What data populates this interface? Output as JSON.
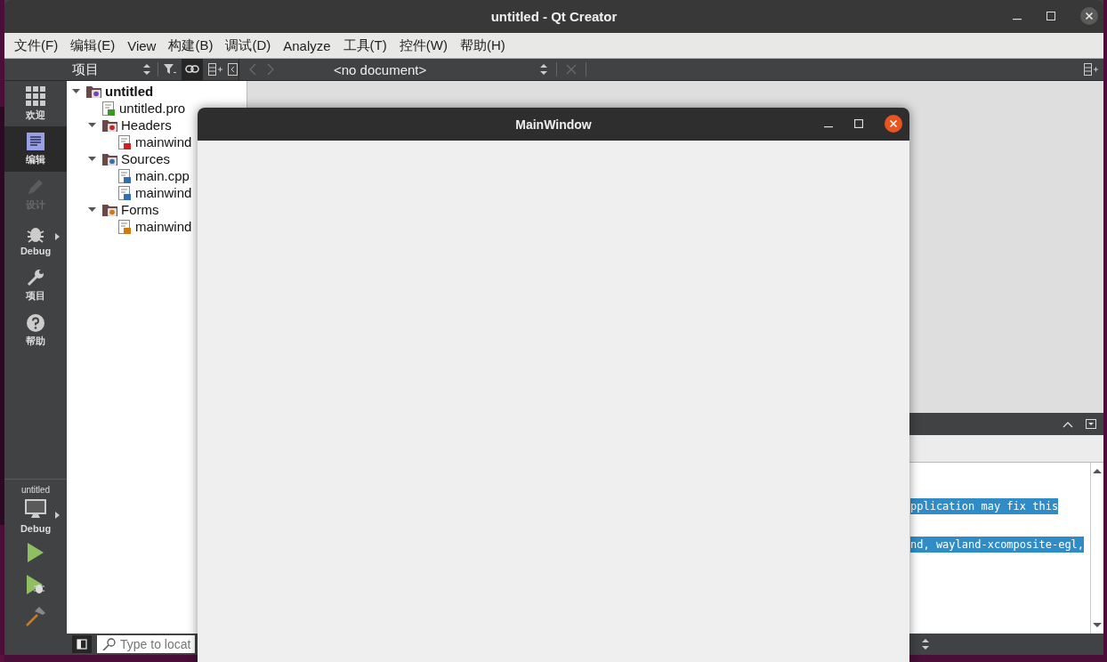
{
  "window": {
    "title": "untitled - Qt Creator"
  },
  "menu": [
    {
      "label": "文件(F)"
    },
    {
      "label": "编辑(E)"
    },
    {
      "label": "View"
    },
    {
      "label": "构建(B)"
    },
    {
      "label": "调试(D)"
    },
    {
      "label": "Analyze"
    },
    {
      "label": "工具(T)"
    },
    {
      "label": "控件(W)"
    },
    {
      "label": "帮助(H)"
    }
  ],
  "sidebar_toolbar": {
    "view": "项目",
    "sync_selected": true
  },
  "editor_toolbar": {
    "document": "<no document>"
  },
  "modes": [
    {
      "kind": "welcome",
      "label": "欢迎",
      "selected": false,
      "disabled": false
    },
    {
      "kind": "edit",
      "label": "编辑",
      "selected": true,
      "disabled": false
    },
    {
      "kind": "design",
      "label": "设计",
      "selected": false,
      "disabled": true
    },
    {
      "kind": "debug",
      "label": "Debug",
      "selected": false,
      "disabled": false
    },
    {
      "kind": "projects",
      "label": "项目",
      "selected": false,
      "disabled": false
    },
    {
      "kind": "help",
      "label": "帮助",
      "selected": false,
      "disabled": false
    }
  ],
  "target": {
    "project": "untitled",
    "build": "Debug"
  },
  "project_tree": [
    {
      "kind": "project",
      "label": "untitled",
      "expanded": true,
      "children": [
        {
          "kind": "pro",
          "label": "untitled.pro"
        },
        {
          "kind": "headers",
          "label": "Headers",
          "expanded": true,
          "children": [
            {
              "kind": "h",
              "label": "mainwind"
            }
          ]
        },
        {
          "kind": "sources",
          "label": "Sources",
          "expanded": true,
          "children": [
            {
              "kind": "cpp",
              "label": "main.cpp"
            },
            {
              "kind": "cpp",
              "label": "mainwind"
            }
          ]
        },
        {
          "kind": "forms",
          "label": "Forms",
          "expanded": true,
          "children": [
            {
              "kind": "ui",
              "label": "mainwind"
            }
          ]
        }
      ]
    }
  ],
  "output": {
    "lines": [
      {
        "text": "pplication may fix this",
        "selected": true
      },
      {
        "text": "nd, wayland-xcomposite-egl,",
        "selected": true
      }
    ]
  },
  "status_bar": {
    "locator_placeholder": "Type to locat"
  },
  "app_window": {
    "title": "MainWindow"
  }
}
